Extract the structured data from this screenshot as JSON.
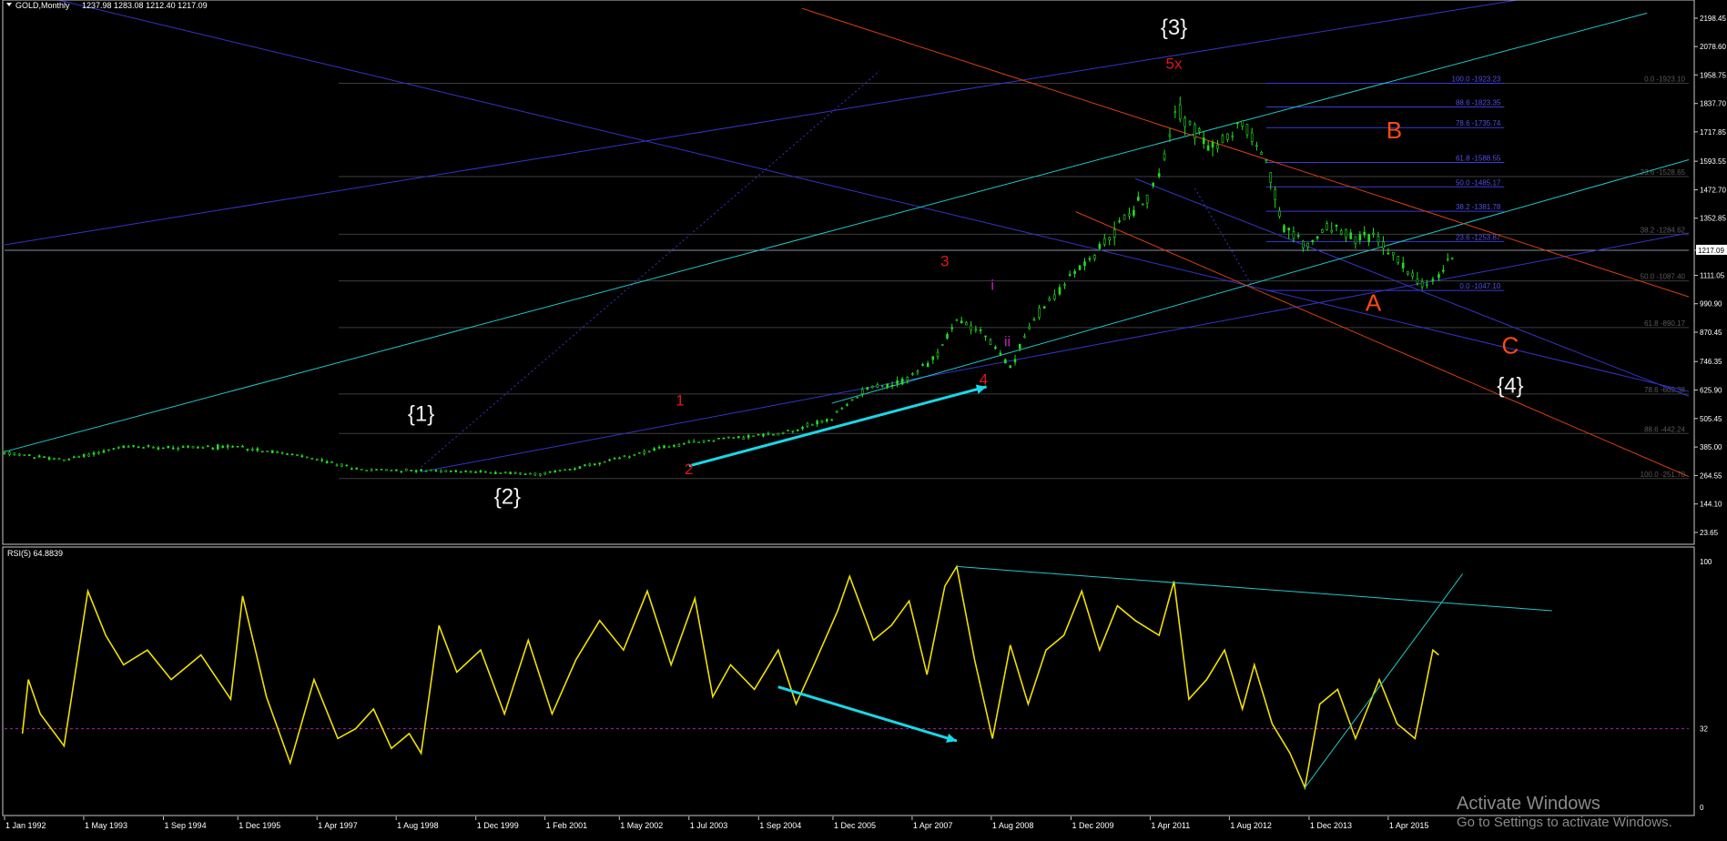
{
  "colors": {
    "background": "#000000",
    "frame": "#c8c8c8",
    "candle": "#22dd22",
    "fib_line": "#3a3ad2",
    "fib_label": "#5050e6",
    "fib_label_right": "#5a5a5a",
    "right_level": "#3c3c3c",
    "trend_blue": "#3434c8",
    "trend_cyan": "#1fc8c8",
    "trend_orange": "#d84010",
    "rsi": "#f0e000",
    "rsi_ref": "#b01eb0",
    "arrow": "#19d8e8",
    "wave_white": "#f0f0f0",
    "wave_red": "#e01818",
    "wave_orange": "#ff4a10",
    "wave_magenta": "#c020c0",
    "axis_text": "#ffffff"
  },
  "header": {
    "symbol": "GOLD,Monthly",
    "ohlc": "1237.98 1283.08 1212.40 1217.09",
    "current_price": "1217.09"
  },
  "rsi_header": {
    "label": "RSI(5) 64.8839",
    "levels": [
      "100",
      "32",
      "0"
    ]
  },
  "watermark": {
    "title": "Activate Windows",
    "subtitle": "Go to Settings to activate Windows."
  },
  "chart_data": [
    {
      "type": "candlestick",
      "title": "GOLD,Monthly",
      "series": [
        {
          "name": "GOLD,Monthly",
          "values": [
            [
              1992.0,
              360
            ],
            [
              1993.0,
              330
            ],
            [
              1994.0,
              385
            ],
            [
              1995.0,
              385
            ],
            [
              1996.0,
              385
            ],
            [
              1997.0,
              345
            ],
            [
              1998.0,
              290
            ],
            [
              1999.0,
              285
            ],
            [
              2000.0,
              280
            ],
            [
              2001.0,
              270
            ],
            [
              2002.0,
              315
            ],
            [
              2003.0,
              380
            ],
            [
              2004.0,
              420
            ],
            [
              2005.0,
              440
            ],
            [
              2005.9,
              505
            ],
            [
              2006.5,
              640
            ],
            [
              2007.0,
              650
            ],
            [
              2007.6,
              750
            ],
            [
              2008.0,
              920
            ],
            [
              2008.4,
              880
            ],
            [
              2008.9,
              720
            ],
            [
              2009.3,
              930
            ],
            [
              2009.9,
              1100
            ],
            [
              2010.4,
              1220
            ],
            [
              2010.9,
              1380
            ],
            [
              2011.2,
              1440
            ],
            [
              2011.4,
              1520
            ],
            [
              2011.67,
              1830
            ],
            [
              2012.0,
              1720
            ],
            [
              2012.3,
              1640
            ],
            [
              2012.8,
              1760
            ],
            [
              2013.2,
              1600
            ],
            [
              2013.5,
              1300
            ],
            [
              2013.9,
              1240
            ],
            [
              2014.3,
              1320
            ],
            [
              2014.7,
              1260
            ],
            [
              2015.0,
              1280
            ],
            [
              2015.5,
              1150
            ],
            [
              2015.9,
              1060
            ],
            [
              2016.1,
              1110
            ],
            [
              2016.4,
              1217
            ]
          ]
        }
      ],
      "price_axis": {
        "tick_labels": [
          "2198.45",
          "2078.60",
          "1958.75",
          "1837.70",
          "1717.85",
          "1593.55",
          "1472.70",
          "1352.85",
          "1217.09",
          "1111.05",
          "990.90",
          "870.45",
          "746.35",
          "625.90",
          "505.45",
          "385.00",
          "264.55",
          "144.10",
          "23.65"
        ],
        "range": [
          23.65,
          2198.45
        ]
      },
      "time_axis": {
        "tick_labels": [
          "1 Jan 1992",
          "1 May 1993",
          "1 Sep 1994",
          "1 Dec 1995",
          "1 Apr 1997",
          "1 Aug 1998",
          "1 Dec 1999",
          "1 Feb 2001",
          "1 May 2002",
          "1 Jul 2003",
          "1 Sep 2004",
          "1 Dec 2005",
          "1 Apr 2007",
          "1 Aug 2008",
          "1 Dec 2009",
          "1 Apr 2011",
          "1 Aug 2012",
          "1 Dec 2013",
          "1 Apr 2015"
        ],
        "range": [
          1992.0,
          2020.3
        ]
      },
      "fibonacci_left": [
        {
          "label": "100.0 -1923.23",
          "level": 1923.23
        },
        {
          "label": "88.6 -1823.35",
          "level": 1823.35
        },
        {
          "label": "78.6 -1735.74",
          "level": 1735.74
        },
        {
          "label": "61.8 -1588.55",
          "level": 1588.55
        },
        {
          "label": "50.0 -1485.17",
          "level": 1485.17
        },
        {
          "label": "38.2 -1381.78",
          "level": 1381.78
        },
        {
          "label": "23.6 -1253.87",
          "level": 1253.87
        },
        {
          "label": "0.0 -1047.10",
          "level": 1047.1
        }
      ],
      "fibonacci_right": [
        {
          "label": "0.0 -1923.10",
          "level": 1923.1
        },
        {
          "label": "23.6 -1528.65",
          "level": 1528.65
        },
        {
          "label": "38.2 -1284.62",
          "level": 1284.62
        },
        {
          "label": "50.0 -1087.40",
          "level": 1087.4
        },
        {
          "label": "61.8 -890.17",
          "level": 890.17
        },
        {
          "label": "78.6 -609.38",
          "level": 609.38
        },
        {
          "label": "88.6 -442.24",
          "level": 442.24
        },
        {
          "label": "100.0 -251.70",
          "level": 251.7
        }
      ],
      "wave_labels": [
        {
          "text": "{1}",
          "x": 1999.0,
          "y": 495,
          "style": "white"
        },
        {
          "text": "{2}",
          "x": 2000.45,
          "y": 145,
          "style": "white"
        },
        {
          "text": "{3}",
          "x": 2011.65,
          "y": 2130,
          "style": "white"
        },
        {
          "text": "5x",
          "x": 2011.65,
          "y": 1985,
          "style": "red"
        },
        {
          "text": "1",
          "x": 2003.35,
          "y": 560,
          "style": "red"
        },
        {
          "text": "2",
          "x": 2003.5,
          "y": 270,
          "style": "red"
        },
        {
          "text": "3",
          "x": 2007.8,
          "y": 1150,
          "style": "red"
        },
        {
          "text": "4",
          "x": 2008.45,
          "y": 650,
          "style": "red"
        },
        {
          "text": "i",
          "x": 2008.6,
          "y": 1050,
          "style": "magenta"
        },
        {
          "text": "ii",
          "x": 2008.85,
          "y": 810,
          "style": "magenta"
        },
        {
          "text": "B",
          "x": 2015.35,
          "y": 1690,
          "style": "orange"
        },
        {
          "text": "A",
          "x": 2015.0,
          "y": 960,
          "style": "orange"
        },
        {
          "text": "C",
          "x": 2017.3,
          "y": 780,
          "style": "orange"
        },
        {
          "text": "{4}",
          "x": 2017.3,
          "y": 615,
          "style": "white"
        }
      ],
      "arrow": {
        "from": [
          2003.5,
          305
        ],
        "to": [
          2008.5,
          640
        ]
      }
    },
    {
      "type": "line",
      "title": "RSI(5) 64.8839",
      "series": [
        {
          "name": "RSI(5)",
          "values": [
            [
              1992.3,
              30
            ],
            [
              1992.4,
              52
            ],
            [
              1992.6,
              38
            ],
            [
              1993.0,
              25
            ],
            [
              1993.4,
              88
            ],
            [
              1993.7,
              70
            ],
            [
              1994.0,
              58
            ],
            [
              1994.4,
              64
            ],
            [
              1994.8,
              52
            ],
            [
              1995.3,
              62
            ],
            [
              1995.8,
              44
            ],
            [
              1996.0,
              86
            ],
            [
              1996.4,
              45
            ],
            [
              1996.8,
              18
            ],
            [
              1997.2,
              52
            ],
            [
              1997.6,
              28
            ],
            [
              1997.9,
              32
            ],
            [
              1998.2,
              40
            ],
            [
              1998.5,
              24
            ],
            [
              1998.8,
              30
            ],
            [
              1999.0,
              22
            ],
            [
              1999.3,
              74
            ],
            [
              1999.6,
              55
            ],
            [
              2000.0,
              64
            ],
            [
              2000.4,
              38
            ],
            [
              2000.8,
              68
            ],
            [
              2001.2,
              38
            ],
            [
              2001.6,
              60
            ],
            [
              2002.0,
              76
            ],
            [
              2002.4,
              64
            ],
            [
              2002.8,
              88
            ],
            [
              2003.2,
              58
            ],
            [
              2003.6,
              85
            ],
            [
              2003.9,
              45
            ],
            [
              2004.2,
              58
            ],
            [
              2004.6,
              48
            ],
            [
              2005.0,
              64
            ],
            [
              2005.3,
              42
            ],
            [
              2005.6,
              58
            ],
            [
              2006.0,
              80
            ],
            [
              2006.2,
              94
            ],
            [
              2006.6,
              68
            ],
            [
              2006.9,
              74
            ],
            [
              2007.2,
              84
            ],
            [
              2007.5,
              54
            ],
            [
              2007.8,
              90
            ],
            [
              2008.0,
              98
            ],
            [
              2008.3,
              60
            ],
            [
              2008.6,
              28
            ],
            [
              2008.9,
              66
            ],
            [
              2009.2,
              42
            ],
            [
              2009.5,
              64
            ],
            [
              2009.8,
              70
            ],
            [
              2010.1,
              88
            ],
            [
              2010.4,
              64
            ],
            [
              2010.7,
              82
            ],
            [
              2011.0,
              76
            ],
            [
              2011.4,
              70
            ],
            [
              2011.65,
              92
            ],
            [
              2011.9,
              44
            ],
            [
              2012.2,
              52
            ],
            [
              2012.5,
              64
            ],
            [
              2012.8,
              40
            ],
            [
              2013.0,
              58
            ],
            [
              2013.3,
              34
            ],
            [
              2013.6,
              22
            ],
            [
              2013.85,
              8
            ],
            [
              2014.1,
              42
            ],
            [
              2014.4,
              48
            ],
            [
              2014.7,
              28
            ],
            [
              2014.9,
              40
            ],
            [
              2015.1,
              52
            ],
            [
              2015.4,
              34
            ],
            [
              2015.7,
              28
            ],
            [
              2016.0,
              64
            ],
            [
              2016.1,
              62
            ]
          ]
        }
      ],
      "y_range": [
        0,
        100
      ],
      "reference_level": 32,
      "arrow": {
        "from": [
          2005.0,
          49
        ],
        "to": [
          2008.0,
          27
        ]
      }
    }
  ]
}
